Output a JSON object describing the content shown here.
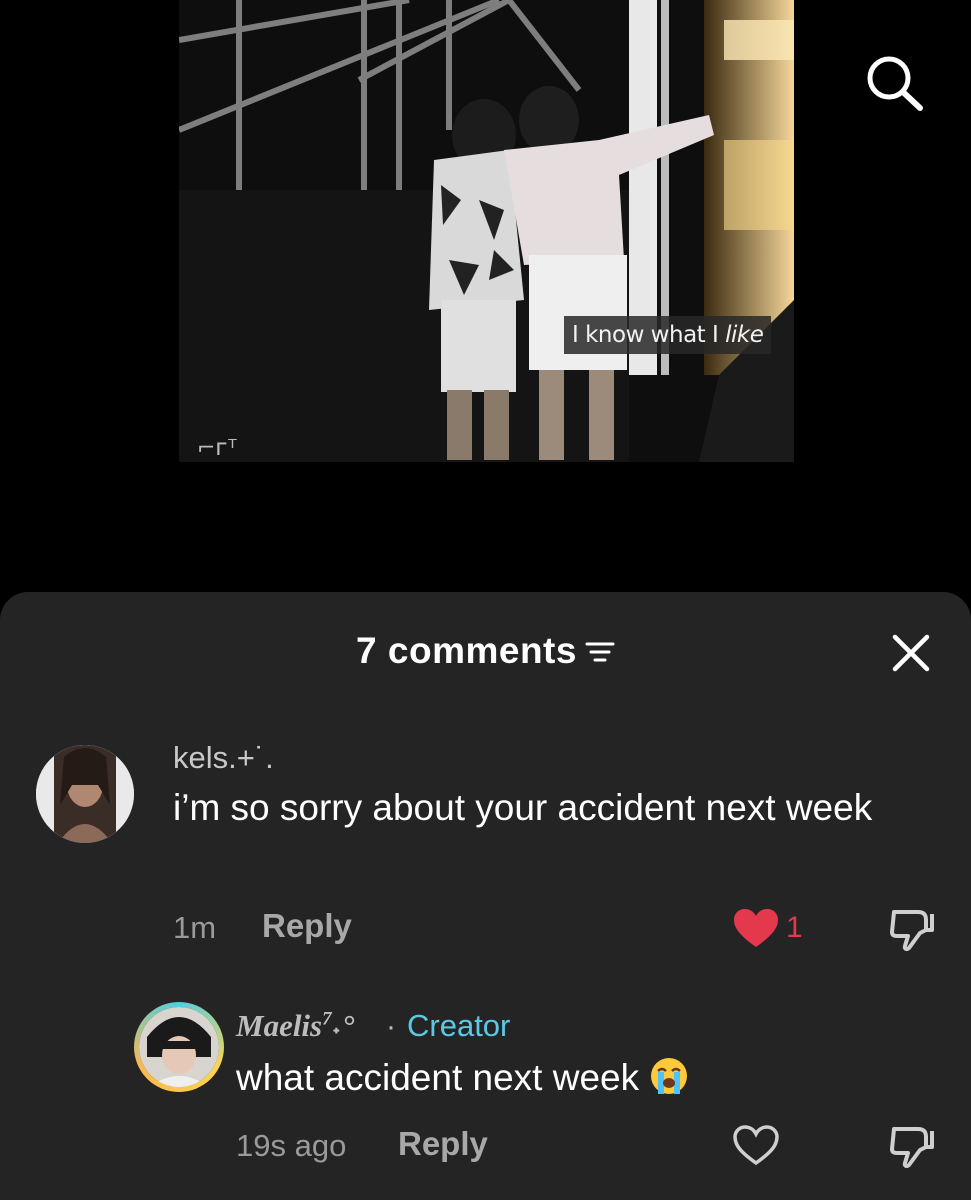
{
  "video": {
    "caption_prefix": "I know what I ",
    "caption_italic": "like"
  },
  "header": {
    "search_icon": "search-icon",
    "comments_count_label": "7 comments",
    "filter_icon": "filter-icon",
    "close_icon": "close-icon"
  },
  "comments": [
    {
      "username": "kels.+˙.",
      "text": "i’m so sorry about your accident next week",
      "time": "1m",
      "reply_label": "Reply",
      "likes": "1",
      "liked": true
    },
    {
      "username": "Maelis",
      "username_suffix": "7",
      "username_tail": "˖°",
      "separator": "·",
      "badge": "Creator",
      "text": "what accident next week",
      "emoji": "loudly-crying-face-icon",
      "time": "19s ago",
      "reply_label": "Reply",
      "liked": false
    }
  ],
  "colors": {
    "sheet_bg": "#242424",
    "like_red": "#e4394d",
    "creator_blue": "#5cc8e6",
    "muted_text": "#9a9a9a"
  }
}
